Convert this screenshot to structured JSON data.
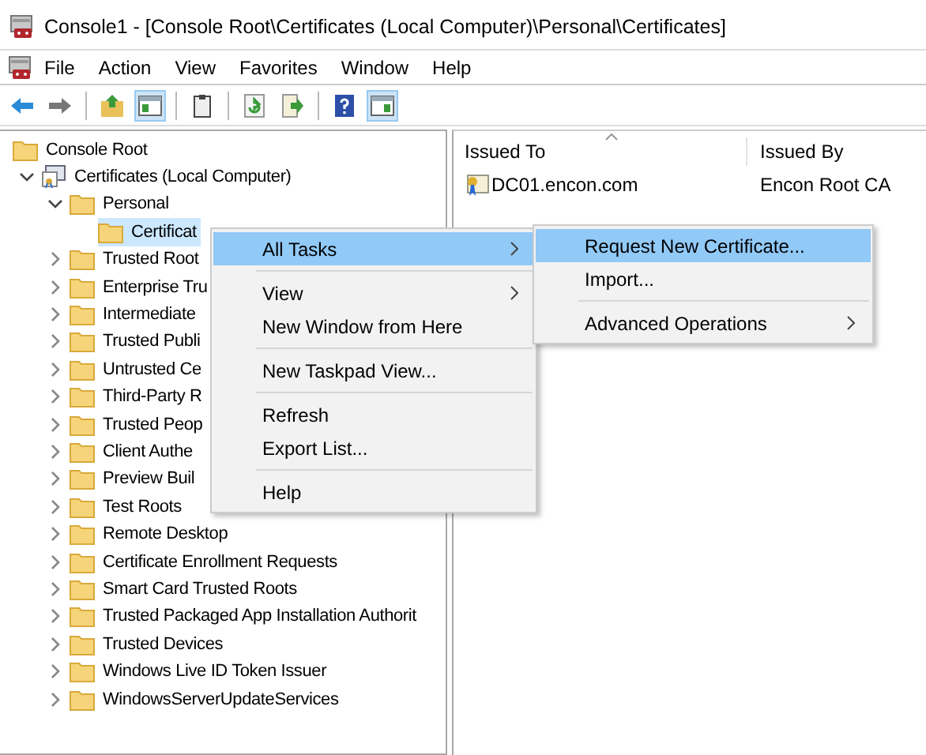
{
  "window": {
    "title": "Console1 - [Console Root\\Certificates (Local Computer)\\Personal\\Certificates]"
  },
  "menu_bar": [
    "File",
    "Action",
    "View",
    "Favorites",
    "Window",
    "Help"
  ],
  "toolbar": [
    {
      "kind": "back",
      "on": false
    },
    {
      "kind": "forward",
      "on": false
    },
    {
      "kind": "separator"
    },
    {
      "kind": "up",
      "on": false
    },
    {
      "kind": "tree",
      "on": true
    },
    {
      "kind": "separator"
    },
    {
      "kind": "clipboard",
      "on": false
    },
    {
      "kind": "separator"
    },
    {
      "kind": "refresh",
      "on": false
    },
    {
      "kind": "export",
      "on": false
    },
    {
      "kind": "separator"
    },
    {
      "kind": "help",
      "on": false
    },
    {
      "kind": "actionpane",
      "on": true
    }
  ],
  "tree": [
    {
      "label": "Console Root",
      "selected": false,
      "children": [
        {
          "label": "Certificates (Local Computer)",
          "selected": false,
          "expanded": true,
          "children": [
            {
              "label": "Personal",
              "selected": false,
              "expanded": true,
              "children": [
                {
                  "label": "Certificat",
                  "selected": true
                }
              ]
            },
            {
              "label": "Trusted Root",
              "selected": false,
              "expanded": false
            },
            {
              "label": "Enterprise Tru",
              "selected": false,
              "expanded": false
            },
            {
              "label": "Intermediate",
              "selected": false,
              "expanded": false
            },
            {
              "label": "Trusted Publi",
              "selected": false,
              "expanded": false
            },
            {
              "label": "Untrusted Ce",
              "selected": false,
              "expanded": false
            },
            {
              "label": "Third-Party R",
              "selected": false,
              "expanded": false
            },
            {
              "label": "Trusted Peop",
              "selected": false,
              "expanded": false
            },
            {
              "label": "Client Authe",
              "selected": false,
              "expanded": false
            },
            {
              "label": "Preview Buil",
              "selected": false,
              "expanded": false
            },
            {
              "label": "Test Roots",
              "selected": false,
              "expanded": false
            },
            {
              "label": "Remote Desktop",
              "selected": false,
              "expanded": false
            },
            {
              "label": "Certificate Enrollment Requests",
              "selected": false,
              "expanded": false
            },
            {
              "label": "Smart Card Trusted Roots",
              "selected": false,
              "expanded": false
            },
            {
              "label": "Trusted Packaged App Installation Authorit",
              "selected": false,
              "expanded": false
            },
            {
              "label": "Trusted Devices",
              "selected": false,
              "expanded": false
            },
            {
              "label": "Windows Live ID Token Issuer",
              "selected": false,
              "expanded": false
            },
            {
              "label": "WindowsServerUpdateServices",
              "selected": false,
              "expanded": false
            }
          ]
        }
      ]
    }
  ],
  "list": {
    "columns": [
      "Issued To",
      "Issued By"
    ],
    "rows": [
      {
        "issued_to": "DC01.encon.com",
        "issued_by": "Encon Root CA"
      }
    ]
  },
  "context_menu": [
    {
      "kind": "item",
      "label": "All Tasks",
      "submenu": true,
      "selected": true
    },
    {
      "kind": "separator"
    },
    {
      "kind": "item",
      "label": "View",
      "submenu": true,
      "selected": false
    },
    {
      "kind": "item",
      "label": "New Window from Here",
      "submenu": false,
      "selected": false
    },
    {
      "kind": "separator"
    },
    {
      "kind": "item",
      "label": "New Taskpad View...",
      "submenu": false,
      "selected": false
    },
    {
      "kind": "separator"
    },
    {
      "kind": "item",
      "label": "Refresh",
      "submenu": false,
      "selected": false
    },
    {
      "kind": "item",
      "label": "Export List...",
      "submenu": false,
      "selected": false
    },
    {
      "kind": "separator"
    },
    {
      "kind": "item",
      "label": "Help",
      "submenu": false,
      "selected": false
    }
  ],
  "submenu": [
    {
      "kind": "item",
      "label": "Request New Certificate...",
      "submenu": false,
      "selected": true
    },
    {
      "kind": "item",
      "label": "Import...",
      "submenu": false,
      "selected": false
    },
    {
      "kind": "separator"
    },
    {
      "kind": "item",
      "label": "Advanced Operations",
      "submenu": true,
      "selected": false
    }
  ]
}
